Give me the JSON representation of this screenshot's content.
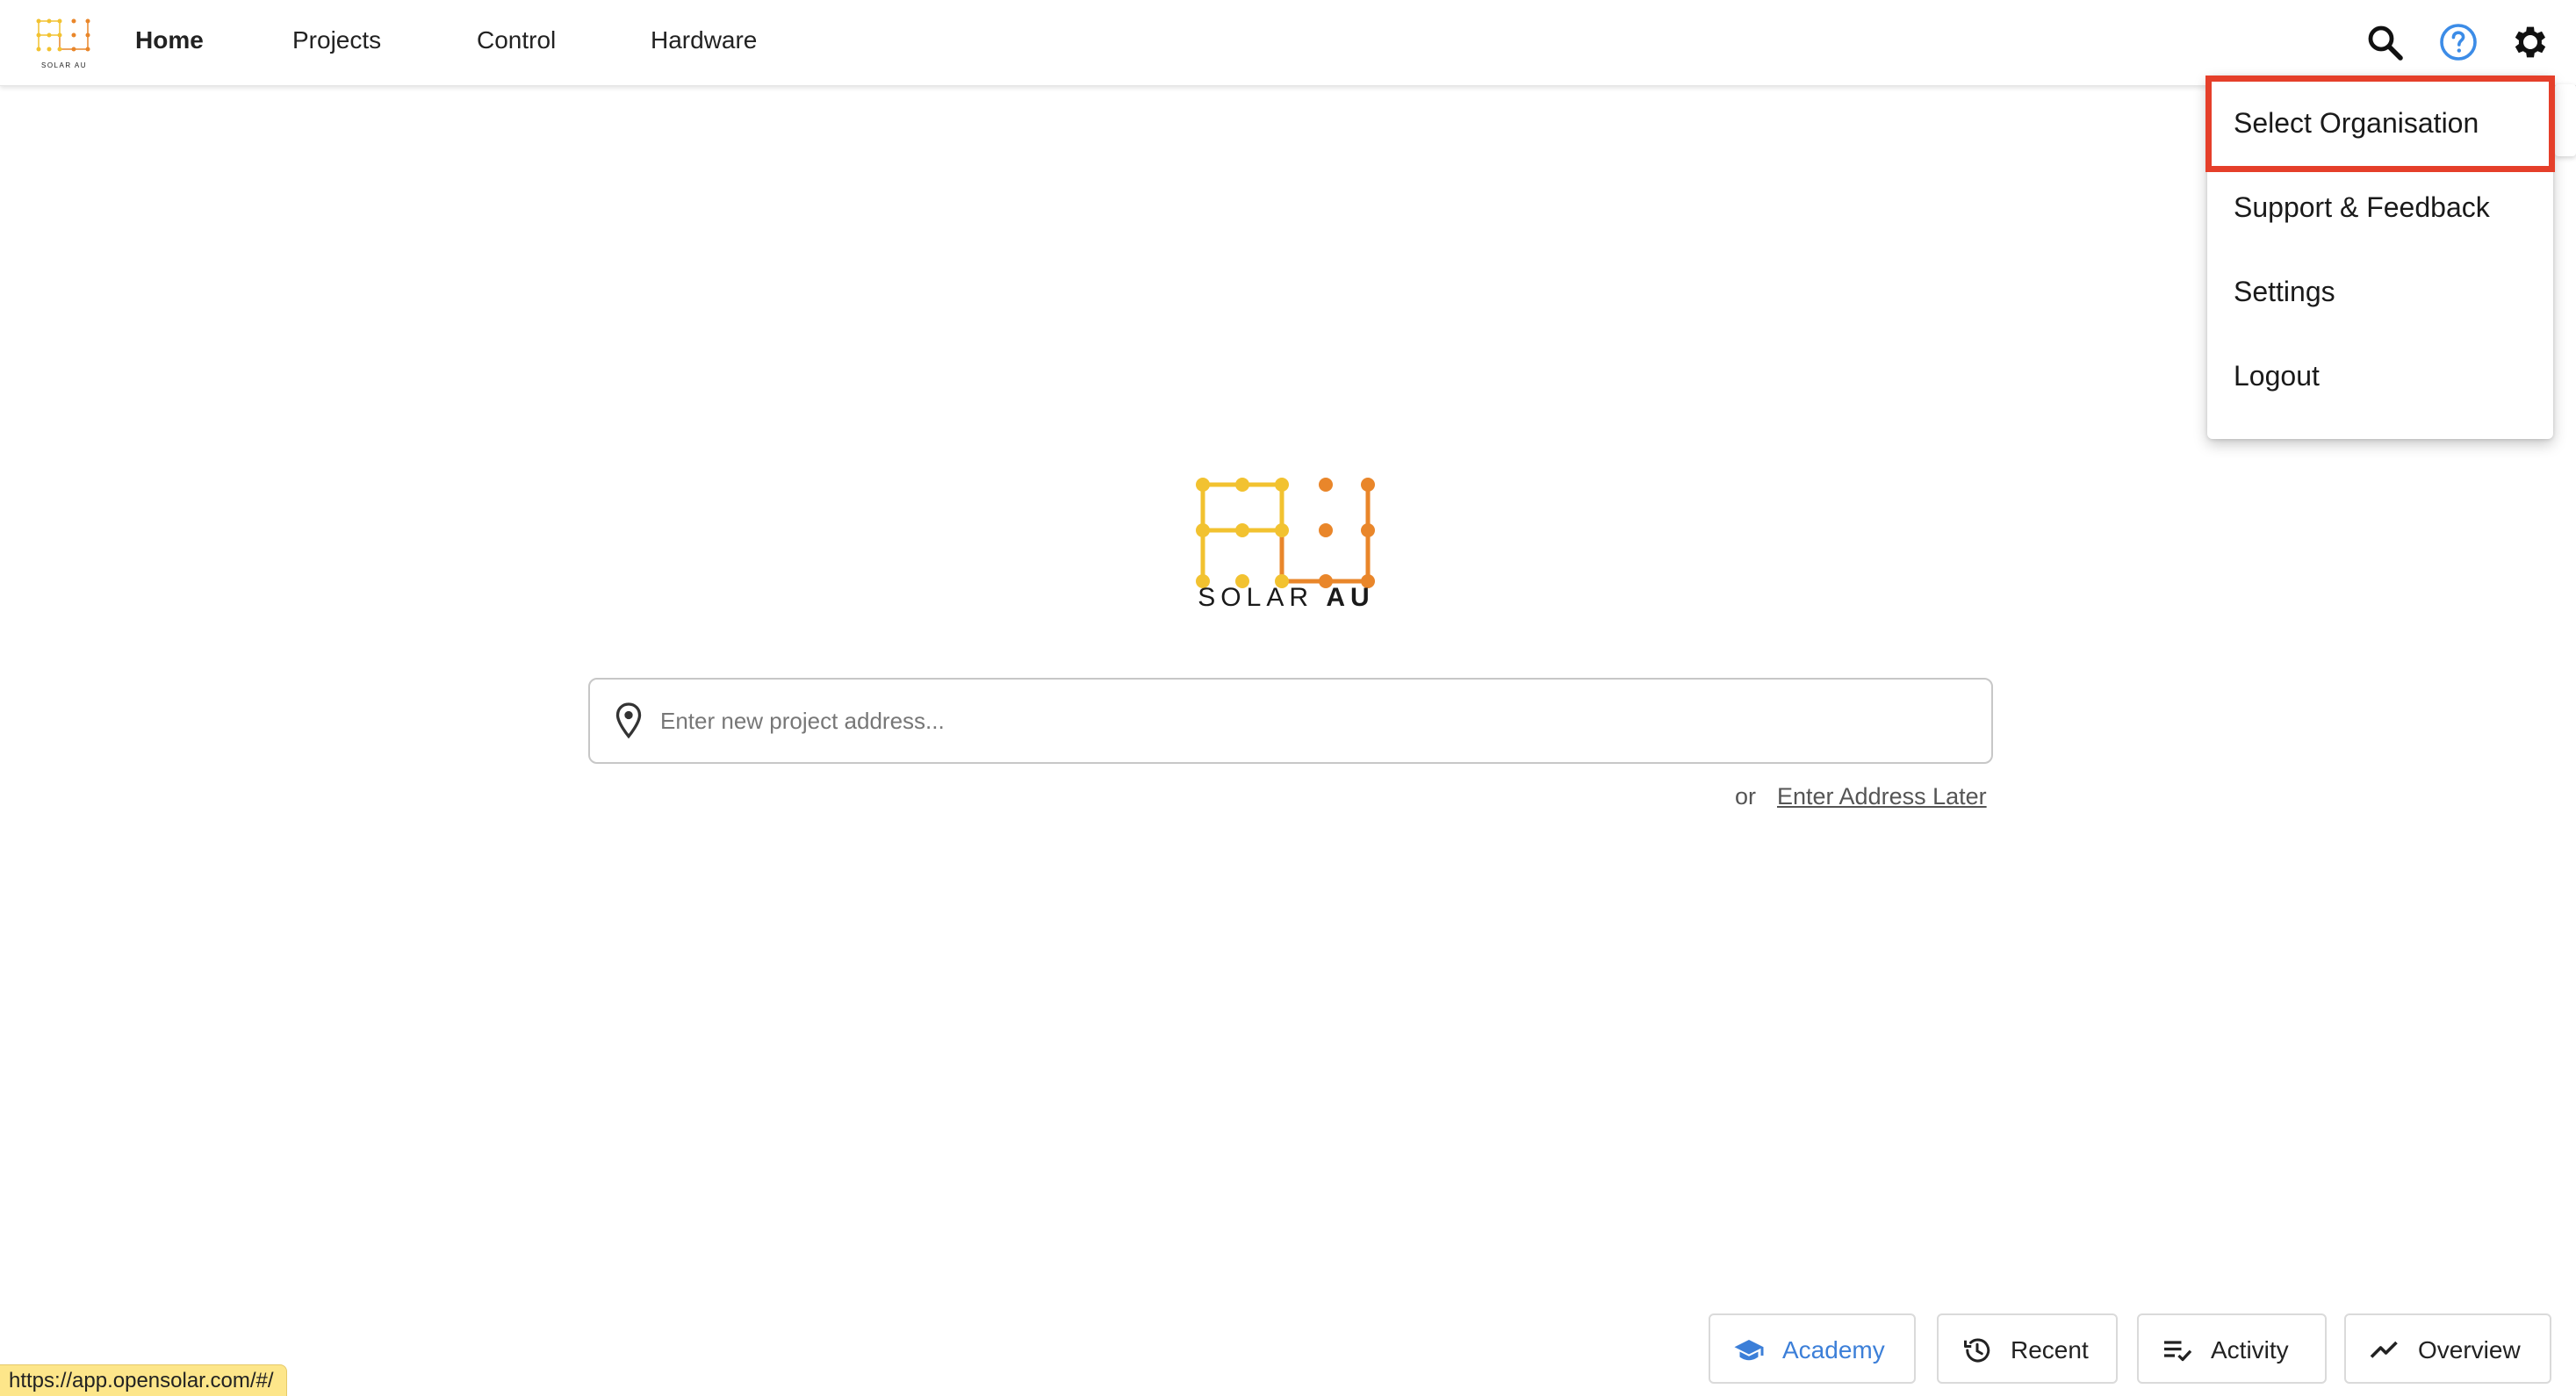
{
  "brand": {
    "logo_small_text": "SOLAR AU",
    "logo_text_light": "SOLAR ",
    "logo_text_bold": "AU"
  },
  "nav": {
    "items": [
      {
        "label": "Home",
        "active": true
      },
      {
        "label": "Projects",
        "active": false
      },
      {
        "label": "Control",
        "active": false
      },
      {
        "label": "Hardware",
        "active": false
      }
    ]
  },
  "toolbar": {
    "search_icon": "search-icon",
    "help_icon": "help-icon",
    "settings_icon": "gear-icon"
  },
  "menu": {
    "items": [
      {
        "label": "Select Organisation",
        "highlighted": true
      },
      {
        "label": "Support & Feedback",
        "highlighted": false
      },
      {
        "label": "Settings",
        "highlighted": false
      },
      {
        "label": "Logout",
        "highlighted": false
      }
    ]
  },
  "address": {
    "placeholder": "Enter new project address...",
    "value": ""
  },
  "later": {
    "or_text": "or",
    "link_text": "Enter Address Later"
  },
  "bottom_buttons": [
    {
      "label": "Academy",
      "icon": "graduation-cap-icon"
    },
    {
      "label": "Recent",
      "icon": "history-icon"
    },
    {
      "label": "Activity",
      "icon": "playlist-check-icon"
    },
    {
      "label": "Overview",
      "icon": "trending-up-icon"
    }
  ],
  "status": {
    "url": "https://app.opensolar.com/#/"
  },
  "colors": {
    "highlight_border": "#e53f2a",
    "accent_blue": "#3c7fd8",
    "logo_yellow": "#f2c230",
    "logo_orange": "#e9862a",
    "status_bg": "#fde68a"
  }
}
